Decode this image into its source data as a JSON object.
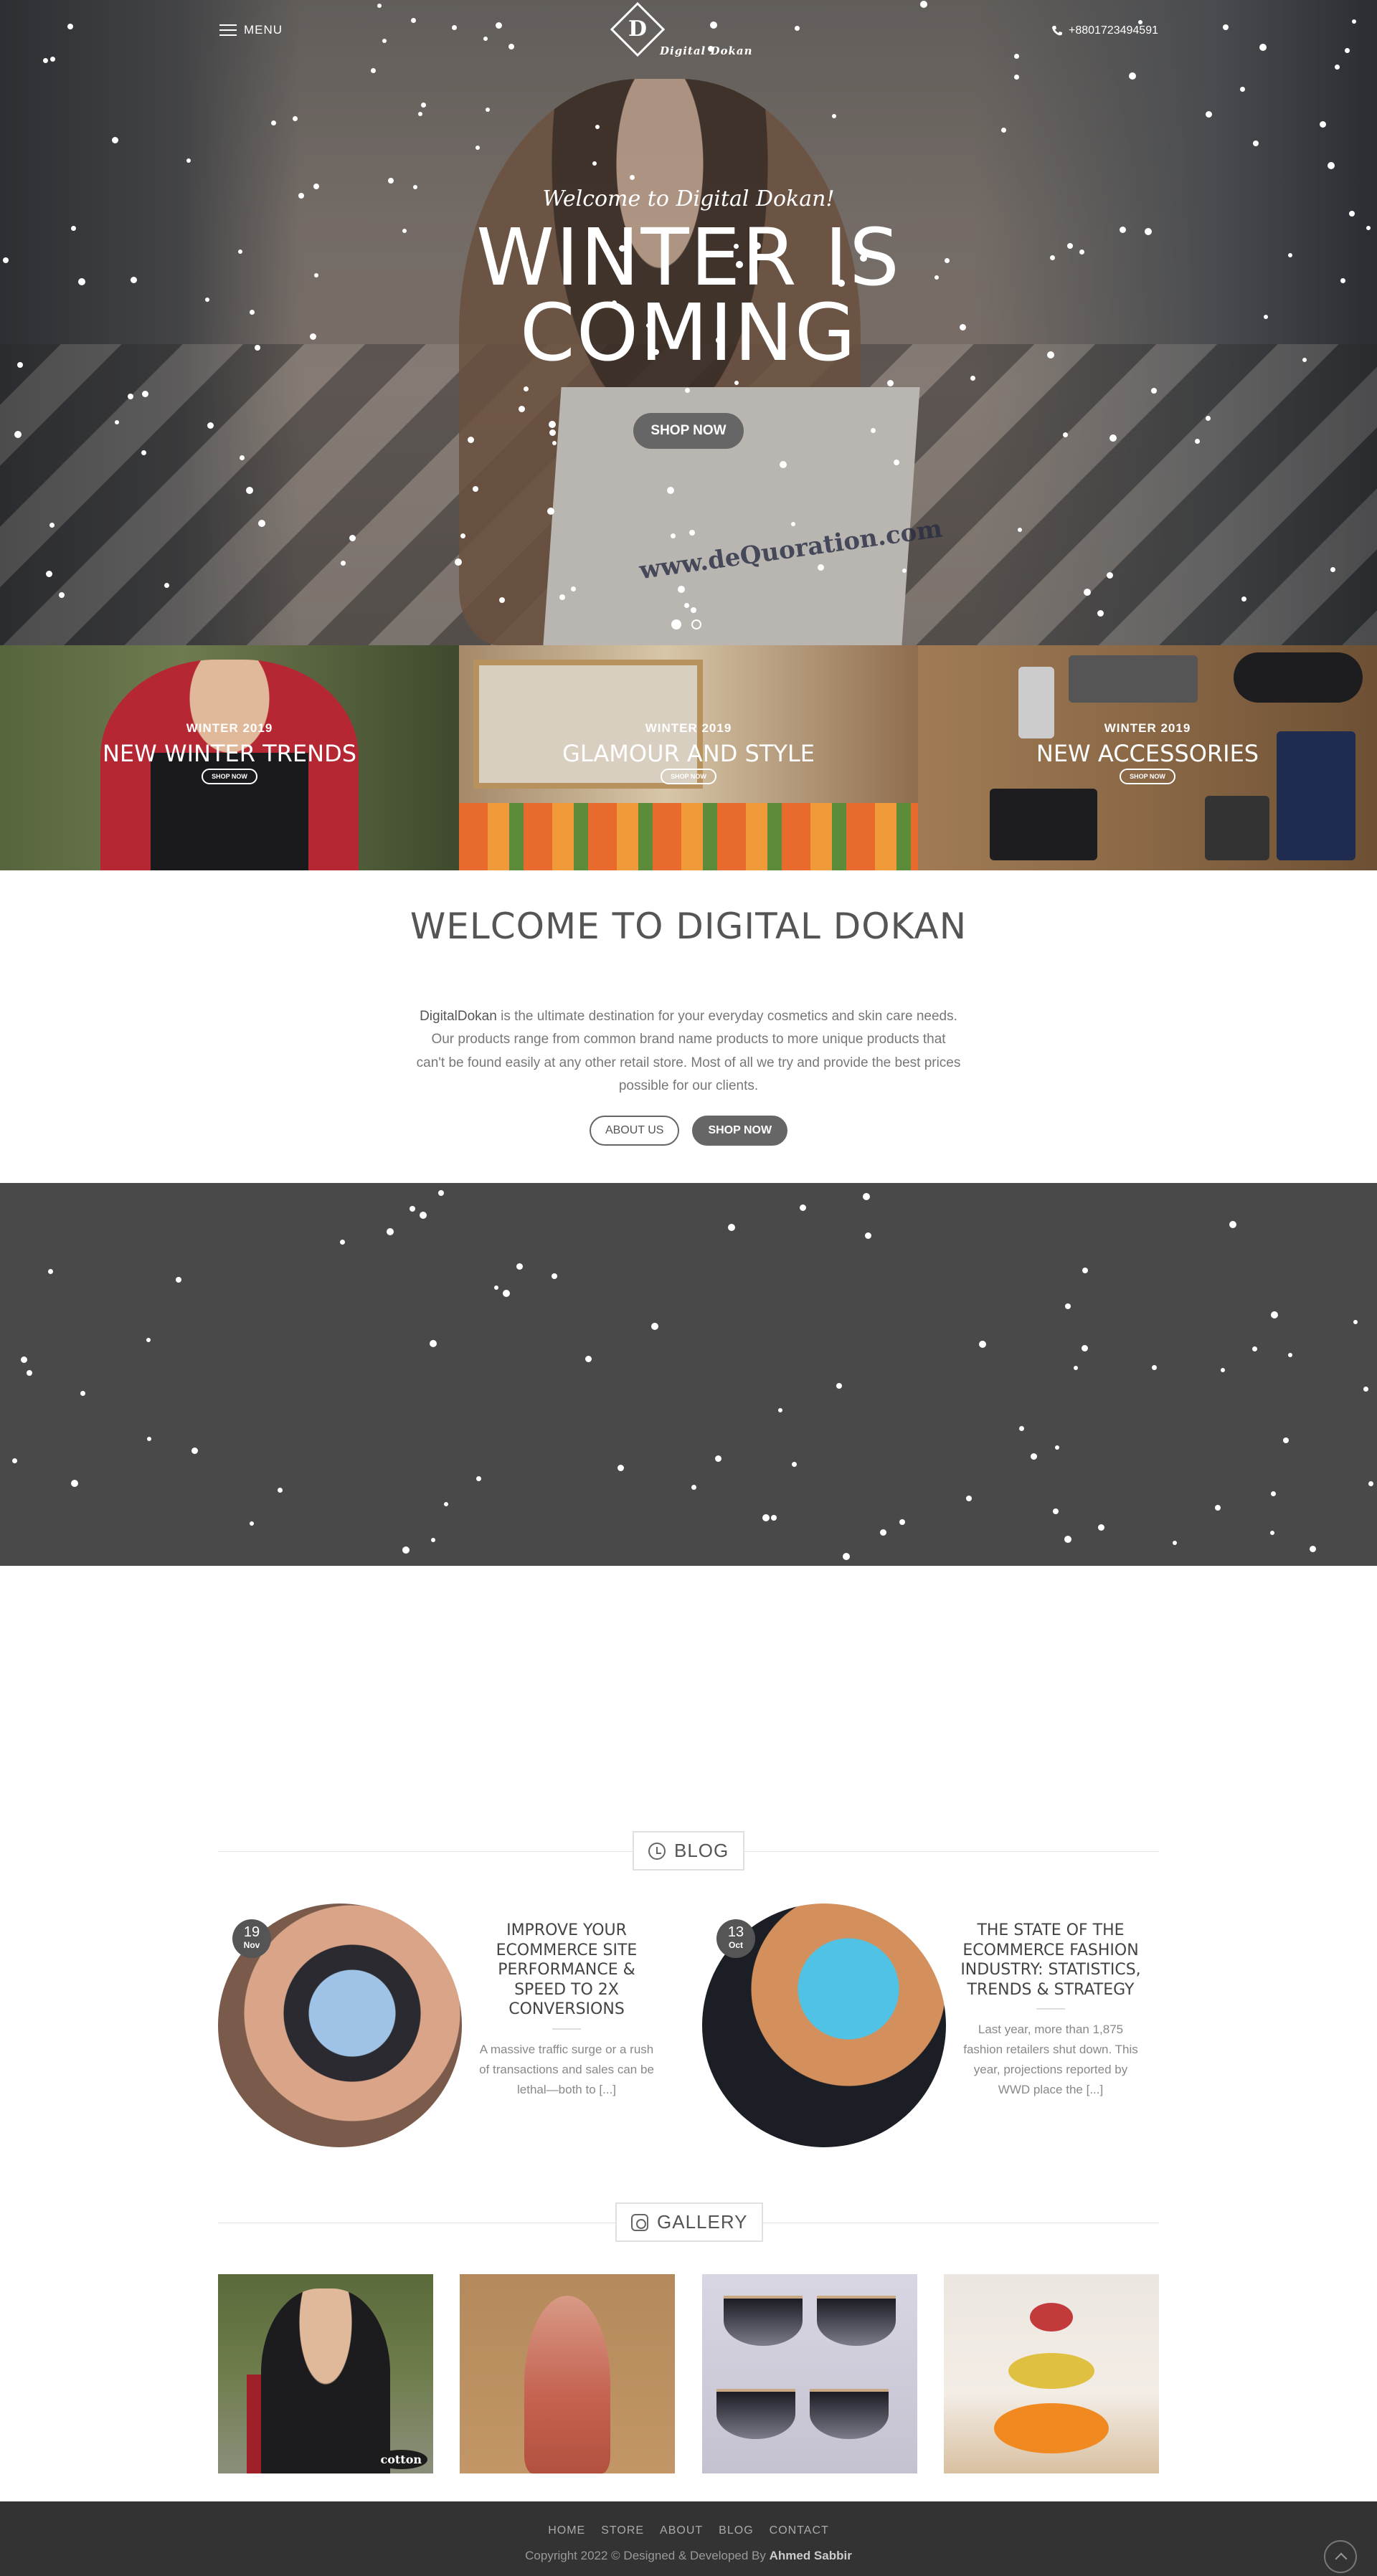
{
  "header": {
    "menu_label": "MENU",
    "logo_letter": "D",
    "logo_text": "Digital Dokan",
    "phone": "+8801723494591"
  },
  "hero": {
    "welcome": "Welcome to Digital Dokan!",
    "title_line1": "WINTER IS",
    "title_line2": "COMING",
    "button": "SHOP NOW",
    "bag_text": "www.deQuoration.com",
    "slides_total": 2,
    "slide_active": 1
  },
  "banners": [
    {
      "subtitle": "WINTER 2019",
      "title": "NEW WINTER TRENDS",
      "button": "SHOP NOW"
    },
    {
      "subtitle": "WINTER 2019",
      "title": "GLAMOUR AND STYLE",
      "button": "SHOP NOW"
    },
    {
      "subtitle": "WINTER 2019",
      "title": "NEW ACCESSORIES",
      "button": "SHOP NOW"
    }
  ],
  "welcome": {
    "title": "WELCOME TO DIGITAL DOKAN",
    "brand": "DigitalDokan",
    "text": " is the ultimate destination for your everyday cosmetics and skin care needs. Our products range from common brand name products to more unique products that can't be found easily at any other retail store. Most of all we try and provide the best prices possible for our clients.",
    "about_button": "ABOUT US",
    "shop_button": "SHOP NOW"
  },
  "blog": {
    "label": "BLOG",
    "posts": [
      {
        "day": "19",
        "month": "Nov",
        "title": "IMPROVE YOUR ECOMMERCE SITE PERFORMANCE & SPEED TO 2X CONVERSIONS",
        "excerpt": "A massive traffic surge or a rush of transactions and sales can be lethal—both to [...]"
      },
      {
        "day": "13",
        "month": "Oct",
        "title": "THE STATE OF THE ECOMMERCE FASHION INDUSTRY: STATISTICS, TRENDS & STRATEGY",
        "excerpt": "Last year, more than 1,875 fashion retailers shut down. This year, projections reported by WWD place the [...]"
      }
    ]
  },
  "gallery": {
    "label": "GALLERY",
    "tag_text": "cotton"
  },
  "footer": {
    "nav": [
      "HOME",
      "STORE",
      "ABOUT",
      "BLOG",
      "CONTACT"
    ],
    "copyright": "Copyright 2022 © Designed & Developed By ",
    "author": "Ahmed Sabbir"
  },
  "colors": {
    "dark_band": "#494949",
    "footer_bg": "#333333",
    "button_gray": "#666666"
  }
}
